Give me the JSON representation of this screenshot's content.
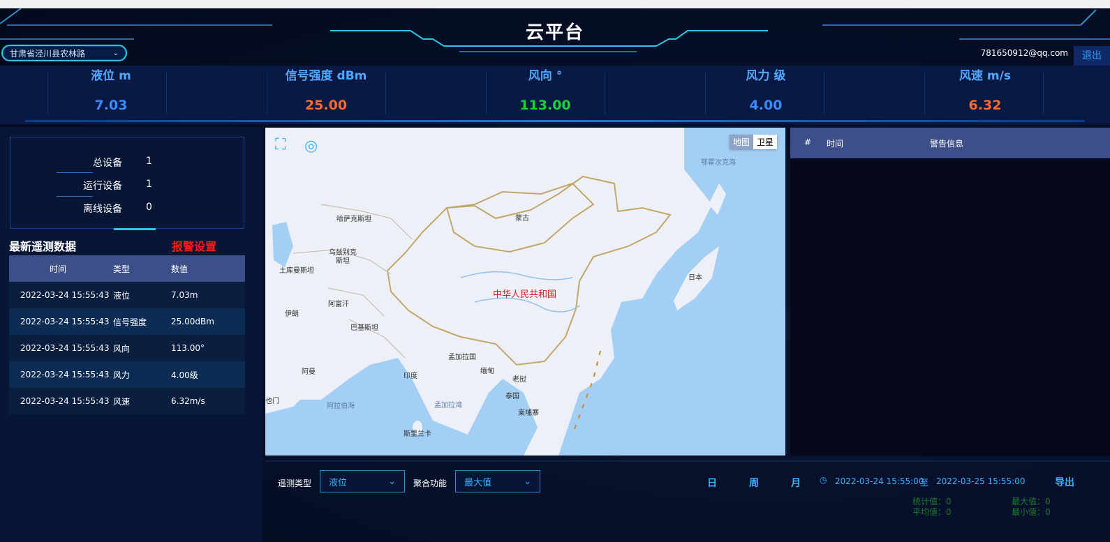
{
  "header": {
    "title": "云平台",
    "region": "甘肃省泾川县农林路",
    "user_email": "781650912@qq.com",
    "logout": "退出"
  },
  "metrics": [
    {
      "label": "液位 m",
      "value": "7.03",
      "color": "#3a8bff"
    },
    {
      "label": "信号强度 dBm",
      "value": "25.00",
      "color": "#ff6a2b"
    },
    {
      "label": "风向 °",
      "value": "113.00",
      "color": "#14d63a"
    },
    {
      "label": "风力 级",
      "value": "4.00",
      "color": "#3a8bff"
    },
    {
      "label": "风速 m/s",
      "value": "6.32",
      "color": "#ff6a2b"
    }
  ],
  "devices": {
    "total_label": "总设备",
    "total": "1",
    "running_label": "运行设备",
    "running": "1",
    "offline_label": "离线设备",
    "offline": "0"
  },
  "latest": {
    "title": "最新遥测数据",
    "alarm_settings": "报警设置",
    "columns": [
      "时间",
      "类型",
      "数值"
    ],
    "rows": [
      {
        "time": "2022-03-24 15:55:43",
        "type": "液位",
        "value": "7.03m"
      },
      {
        "time": "2022-03-24 15:55:43",
        "type": "信号强度",
        "value": "25.00dBm"
      },
      {
        "time": "2022-03-24 15:55:43",
        "type": "风向",
        "value": "113.00°"
      },
      {
        "time": "2022-03-24 15:55:43",
        "type": "风力",
        "value": "4.00级"
      },
      {
        "time": "2022-03-24 15:55:43",
        "type": "风速",
        "value": "6.32m/s"
      }
    ]
  },
  "map": {
    "toggle_map": "地图",
    "toggle_satellite": "卫星",
    "labels": {
      "okhotsk": "鄂霍次克海",
      "kazakhstan": "哈萨克斯坦",
      "mongolia": "蒙古",
      "uzbekistan": "乌兹别克斯坦",
      "turkmenistan": "土库曼斯坦",
      "china": "中华人民共和国",
      "japan": "日本",
      "afghanistan": "阿富汗",
      "iran": "伊朗",
      "pakistan": "巴基斯坦",
      "bangladesh": "孟加拉国",
      "myanmar": "缅甸",
      "laos": "老挝",
      "oman": "阿曼",
      "india": "印度",
      "thailand": "泰国",
      "yemen": "也门",
      "arabian_sea": "阿拉伯海",
      "bay_of_bengal": "孟加拉湾",
      "cambodia": "柬埔寨",
      "sri_lanka": "斯里兰卡"
    }
  },
  "alerts": {
    "columns": [
      "#",
      "时间",
      "警告信息"
    ]
  },
  "controls": {
    "telemetry_type_label": "遥测类型",
    "telemetry_type_value": "液位",
    "aggregate_label": "聚合功能",
    "aggregate_value": "最大值",
    "day": "日",
    "week": "周",
    "month": "月",
    "start_time": "2022-03-24 15:55:00",
    "to": "至",
    "end_time": "2022-03-25 15:55:00",
    "export": "导出",
    "stats": {
      "sum": "统计值：0",
      "avg": "平均值：0",
      "max": "最大值：0",
      "min": "最小值：0"
    }
  }
}
